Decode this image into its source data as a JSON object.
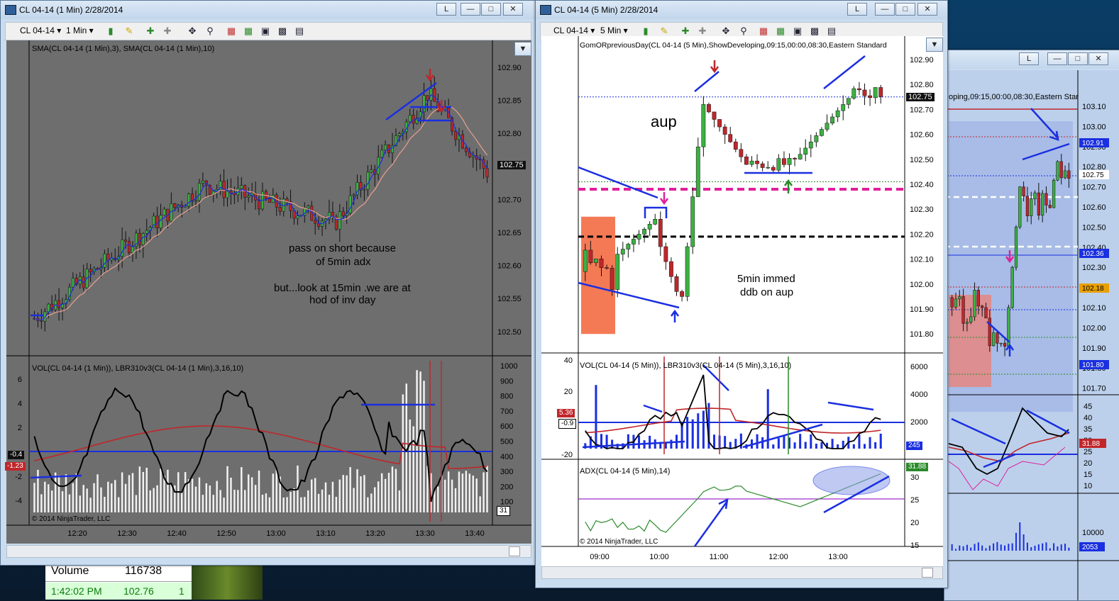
{
  "window1": {
    "title": "CL 04-14 (1 Min)  2/28/2014",
    "toolbar": {
      "instrument": "CL 04-14 ▾",
      "interval": "1 Min ▾"
    },
    "price_header": "SMA(CL 04-14 (1 Min),3), SMA(CL 04-14 (1 Min),10)",
    "price_axis": [
      "102.90",
      "102.85",
      "102.80",
      "102.75",
      "102.70",
      "102.65",
      "102.60",
      "102.55",
      "102.50"
    ],
    "last_price": "102.75",
    "notes": [
      "pass on short because",
      "of 5min adx",
      "but...look at 15min .we are at",
      "hod of inv day"
    ],
    "indicator_header": "VOL(CL 04-14 (1 Min)), LBR310v3(CL 04-14 (1 Min),3,16,10)",
    "ind_left_axis": [
      "6",
      "4",
      "2",
      "-2",
      "-4"
    ],
    "ind_right_axis": [
      "1000",
      "900",
      "800",
      "700",
      "600",
      "500",
      "400",
      "300",
      "200",
      "100"
    ],
    "tag_a": "-0.4",
    "tag_b": "-1.23",
    "tag_vol": "31",
    "copyright": "© 2014 NinjaTrader, LLC",
    "time_axis": [
      "12:20",
      "12:30",
      "12:40",
      "12:50",
      "13:00",
      "13:10",
      "13:20",
      "13:30",
      "13:40"
    ]
  },
  "window2": {
    "title": "CL 04-14 (5 Min)  2/28/2014",
    "toolbar": {
      "instrument": "CL 04-14 ▾",
      "interval": "5 Min ▾"
    },
    "price_header": "GomORpreviousDay(CL 04-14 (5 Min),ShowDeveloping,09:15,00:00,08:30,Eastern Standard",
    "price_axis": [
      "102.90",
      "102.80",
      "102.70",
      "102.60",
      "102.50",
      "102.40",
      "102.30",
      "102.20",
      "102.10",
      "102.00",
      "101.90",
      "101.80"
    ],
    "last_price": "102.75",
    "note_aup": "aup",
    "note_ddb": [
      "5min immed",
      "ddb on aup"
    ],
    "indicator_header": "VOL(CL 04-14 (5 Min)), LBR310v3(CL 04-14 (5 Min),3,16,10)",
    "ind_left_axis": [
      "40",
      "20",
      "-20"
    ],
    "ind_right_axis": [
      "6000",
      "4000",
      "2000"
    ],
    "tag_a": "5.36",
    "tag_b": "-0.9",
    "tag_vol": "245",
    "adx_header": "ADX(CL 04-14 (5 Min),14)",
    "adx_axis": [
      "30",
      "25",
      "20",
      "15"
    ],
    "adx_tag": "31.88",
    "copyright": "© 2014 NinjaTrader, LLC",
    "time_axis": [
      "09:00",
      "10:00",
      "11:00",
      "12:00",
      "13:00"
    ]
  },
  "window3": {
    "price_header": "oping,09:15,00:00,08:30,Eastern Star",
    "price_axis": [
      "103.10",
      "103.00",
      "102.90",
      "102.80",
      "102.70",
      "102.60",
      "102.50",
      "102.40",
      "102.30",
      "102.20",
      "102.10",
      "102.00",
      "101.90",
      "101.80",
      "101.70"
    ],
    "tags": [
      "102.91",
      "102.75",
      "102.36",
      "102.18",
      "101.80"
    ],
    "ind_axis": [
      "45",
      "40",
      "35",
      "30",
      "25",
      "20",
      "15",
      "10"
    ],
    "ind_tag": "31.88",
    "vol_axis": [
      "10000",
      "5000"
    ],
    "vol_tag": "2053"
  },
  "dom": {
    "volume_label": "Volume",
    "volume_value": "116738",
    "row_time": "1:42:02 PM",
    "row_price": "102.76",
    "row_size": "1"
  },
  "colors": {
    "chart_bg_1min": "#6e6e6e",
    "chart_bg_5min": "#ffffff",
    "up_candle": "#3cb043",
    "down_candle": "#c0262a",
    "trend_line": "#1a2fe0",
    "sma_fast": "#1a2fe0",
    "sma_slow": "#e8a090",
    "magenta": "#e0209a"
  }
}
